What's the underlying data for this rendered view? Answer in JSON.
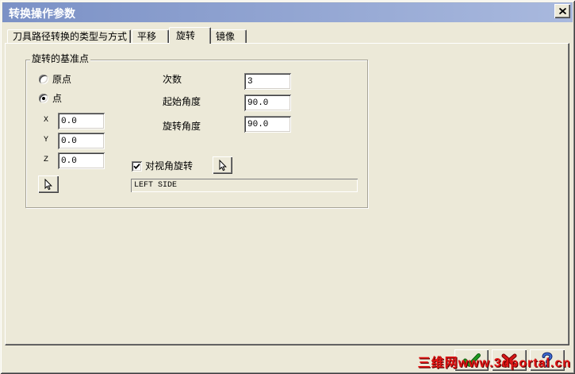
{
  "window": {
    "title": "转换操作参数",
    "close_icon": "close-icon"
  },
  "tabs": [
    {
      "label": "刀具路径转换的类型与方式",
      "selected": false
    },
    {
      "label": "平移",
      "selected": false
    },
    {
      "label": "旋转",
      "selected": true
    },
    {
      "label": "镜像",
      "selected": false
    }
  ],
  "base_point": {
    "title": "旋转的基准点",
    "options": [
      {
        "label": "原点",
        "checked": false
      },
      {
        "label": "点",
        "checked": true
      }
    ],
    "coords": [
      {
        "label": "X",
        "value": "0.0"
      },
      {
        "label": "Y",
        "value": "0.0"
      },
      {
        "label": "Z",
        "value": "0.0"
      }
    ],
    "pick_icon": "cursor-arrow-icon"
  },
  "params": {
    "count": {
      "label": "次数",
      "value": "3"
    },
    "start_angle": {
      "label": "起始角度",
      "value": "90.0"
    },
    "rotate_angle": {
      "label": "旋转角度",
      "value": "90.0"
    }
  },
  "view_rotate": {
    "label": "对视角旋转",
    "checked": true,
    "view_name": "LEFT SIDE",
    "pick_icon": "cursor-arrow-icon"
  },
  "footer": {
    "ok_icon": "checkmark-icon",
    "cancel_icon": "cross-icon",
    "help_icon": "help-question-icon",
    "watermark": "三维网www.3dportal.cn"
  },
  "colors": {
    "face": "#ece9d8",
    "title_start": "#7b91c6",
    "title_end": "#a9b9de",
    "ok_green": "#1f9a1f",
    "cancel_red": "#d81818",
    "help_blue": "#3f6fd8",
    "watermark_red": "#e01414"
  }
}
